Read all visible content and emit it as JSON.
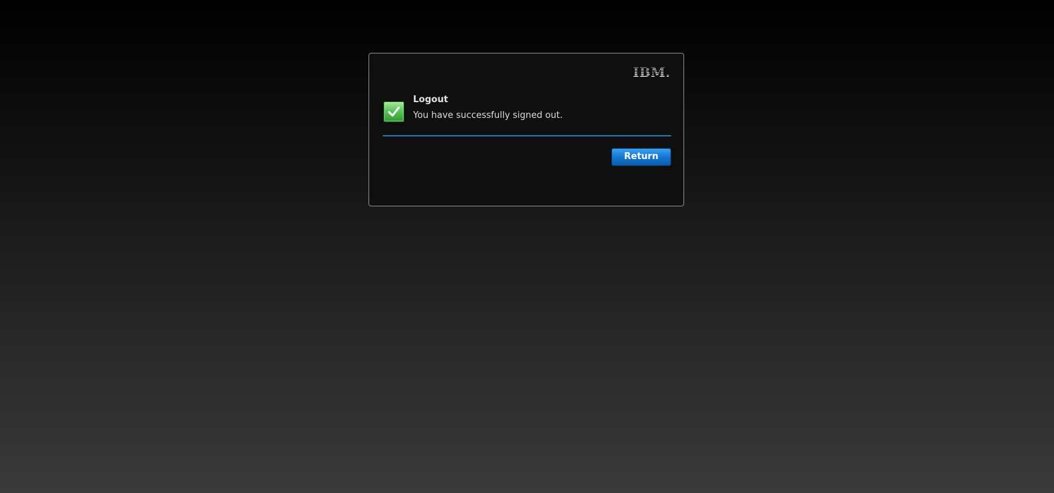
{
  "brand": {
    "logo_text": "IBM."
  },
  "dialog": {
    "status_icon": "checkmark-success-icon",
    "title": "Logout",
    "message": "You have successfully signed out.",
    "return_label": "Return"
  },
  "colors": {
    "accent": "#1f79b8",
    "button": "#1477d1",
    "success": "#5bc45a"
  }
}
